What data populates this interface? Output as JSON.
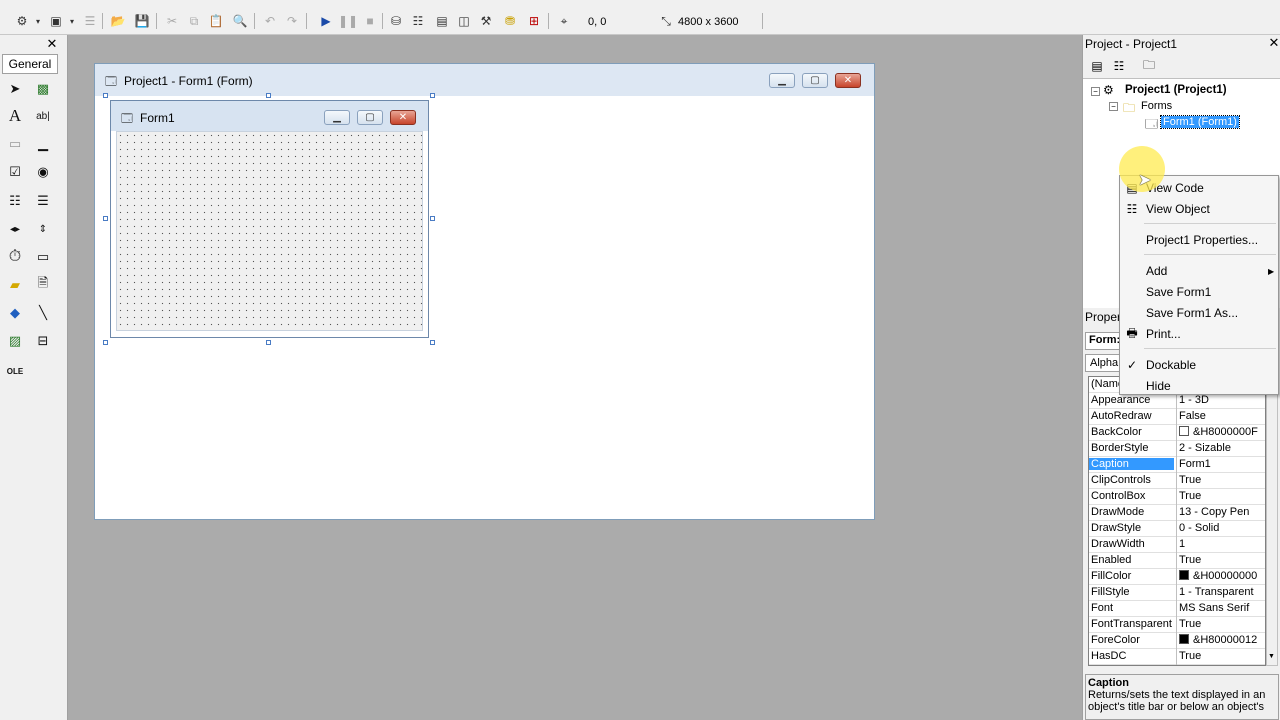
{
  "toolbar": {
    "coords": "0, 0",
    "size": "4800 x 3600"
  },
  "toolbox": {
    "tab": "General",
    "close": "✕"
  },
  "designer": {
    "project_window_title": "Project1 - Form1 (Form)",
    "form_title": "Form1"
  },
  "project_explorer": {
    "title": "Project - Project1",
    "root": "Project1 (Project1)",
    "folder": "Forms",
    "node": "Form1 (Form1)"
  },
  "context_menu": {
    "items": [
      "View Code",
      "View Object",
      "Project1 Properties...",
      "Add",
      "Save Form1",
      "Save Form1 As...",
      "Print...",
      "Dockable",
      "Hide"
    ]
  },
  "properties": {
    "title": "Proper",
    "object": "Form:",
    "tab": "Alpha",
    "rows": [
      {
        "name": "(Name",
        "value": ""
      },
      {
        "name": "Appearance",
        "value": "1 - 3D"
      },
      {
        "name": "AutoRedraw",
        "value": "False"
      },
      {
        "name": "BackColor",
        "value": "&H8000000F"
      },
      {
        "name": "BorderStyle",
        "value": "2 - Sizable"
      },
      {
        "name": "Caption",
        "value": "Form1"
      },
      {
        "name": "ClipControls",
        "value": "True"
      },
      {
        "name": "ControlBox",
        "value": "True"
      },
      {
        "name": "DrawMode",
        "value": "13 - Copy Pen"
      },
      {
        "name": "DrawStyle",
        "value": "0 - Solid"
      },
      {
        "name": "DrawWidth",
        "value": "1"
      },
      {
        "name": "Enabled",
        "value": "True"
      },
      {
        "name": "FillColor",
        "value": "&H00000000"
      },
      {
        "name": "FillStyle",
        "value": "1 - Transparent"
      },
      {
        "name": "Font",
        "value": "MS Sans Serif"
      },
      {
        "name": "FontTransparent",
        "value": "True"
      },
      {
        "name": "ForeColor",
        "value": "&H80000012"
      },
      {
        "name": "HasDC",
        "value": "True"
      }
    ],
    "desc_title": "Caption",
    "desc_text": "Returns/sets the text displayed in an object's title bar or below an object's"
  }
}
